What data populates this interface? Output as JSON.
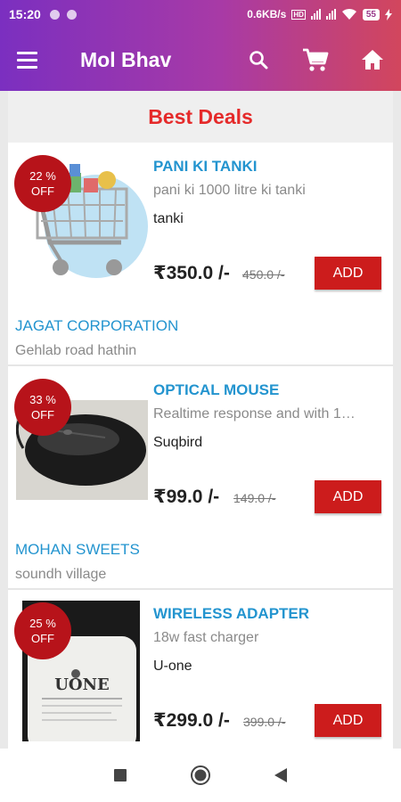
{
  "status_bar": {
    "time": "15:20",
    "network_speed": "0.6KB/s",
    "battery": "55"
  },
  "app_bar": {
    "title": "Mol Bhav",
    "icons": [
      "menu-icon",
      "search-icon",
      "cart-icon",
      "home-icon"
    ]
  },
  "section": {
    "title": "Best Deals"
  },
  "products": [
    {
      "discount_line1": "22 %",
      "discount_line2": "OFF",
      "name": "PANI KI TANKI",
      "description": "pani ki 1000 litre ki tanki",
      "brand": "tanki",
      "price": "₹350.0 /-",
      "mrp": "450.0 /-",
      "add_label": "ADD",
      "shop_name": "JAGAT CORPORATION",
      "shop_address": "Gehlab road hathin"
    },
    {
      "discount_line1": "33 %",
      "discount_line2": "OFF",
      "name": "OPTICAL MOUSE",
      "description": "Realtime response and with 1…",
      "brand": "Suqbird",
      "price": "₹99.0 /-",
      "mrp": "149.0 /-",
      "add_label": "ADD",
      "shop_name": "MOHAN SWEETS",
      "shop_address": "soundh village"
    },
    {
      "discount_line1": "25 %",
      "discount_line2": "OFF",
      "name": "WIRELESS ADAPTER",
      "description": "18w fast charger",
      "brand": "U-one",
      "price": "₹299.0 /-",
      "mrp": "399.0 /-",
      "add_label": "ADD",
      "adapter_label": "UONE"
    }
  ],
  "colors": {
    "accent_gradient_start": "#7b2fc0",
    "accent_gradient_end": "#d2465d",
    "section_title": "#e52a2a",
    "product_name": "#2394cf",
    "add_button": "#cc1c1c",
    "badge": "#b7131a"
  },
  "nav_bar": {
    "icons": [
      "recents-icon",
      "home-circle-icon",
      "back-icon"
    ]
  }
}
